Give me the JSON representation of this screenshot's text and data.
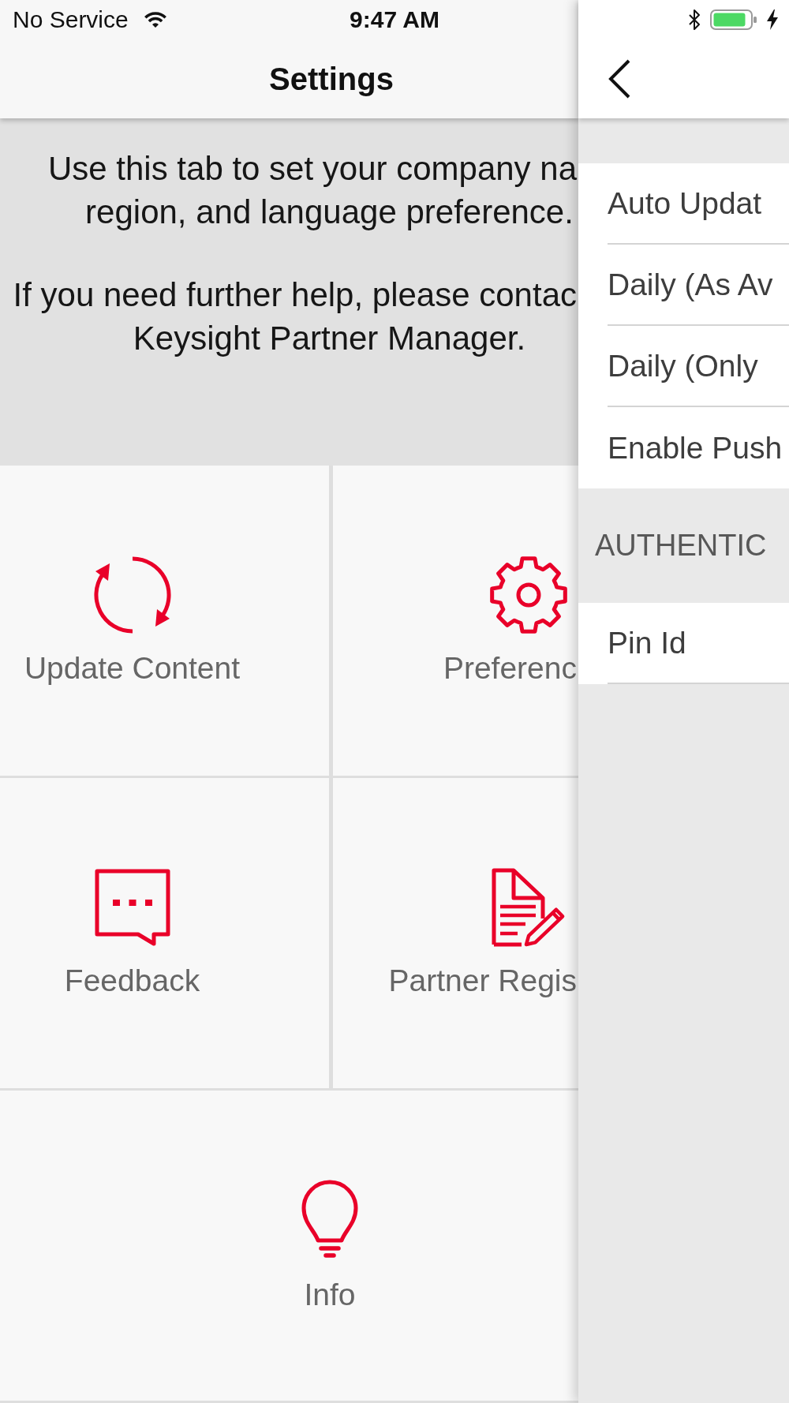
{
  "status_bar": {
    "carrier": "No Service",
    "time": "9:47 AM"
  },
  "main": {
    "title": "Settings",
    "description": [
      [
        "Use this tab to set your company na",
        "region, and language preference."
      ],
      [
        "If you need further help, please contac",
        "Keysight Partner Manager."
      ]
    ],
    "tiles": [
      {
        "kind": "refresh",
        "label": "Update Content"
      },
      {
        "kind": "gear",
        "label": "Preferenc"
      },
      {
        "kind": "chat",
        "label": "Feedback"
      },
      {
        "kind": "document",
        "label": "Partner Regis"
      },
      {
        "kind": "bulb",
        "label": "Info"
      }
    ]
  },
  "panel": {
    "sections": [
      {
        "rows": [
          "Auto Updat",
          "Daily (As Av",
          "Daily (Only",
          "Enable Push"
        ]
      },
      {
        "header": "AUTHENTIC",
        "rows": [
          "Pin Id"
        ]
      }
    ]
  }
}
